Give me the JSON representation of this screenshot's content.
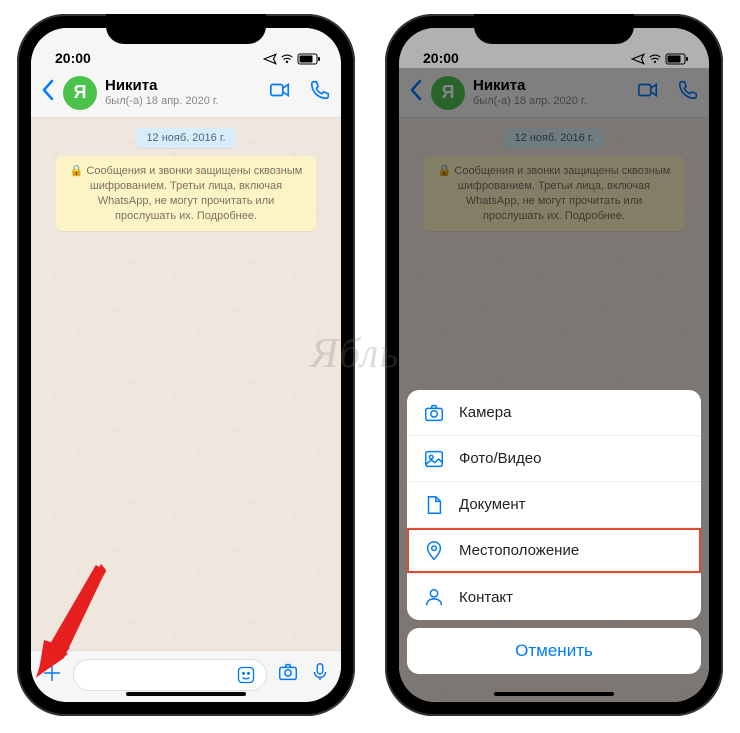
{
  "watermark": "Яблык",
  "status": {
    "time": "20:00"
  },
  "chat": {
    "avatar_letter": "Я",
    "name": "Никита",
    "last_seen": "был(-а) 18 апр. 2020 г.",
    "date_pill": "12 нояб. 2016 г.",
    "encryption_notice": "🔒 Сообщения и звонки защищены сквозным шифрованием. Третьи лица, включая WhatsApp, не могут прочитать или прослушать их. Подробнее."
  },
  "sheet": {
    "camera": "Камера",
    "photo_video": "Фото/Видео",
    "document": "Документ",
    "location": "Местоположение",
    "contact": "Контакт",
    "cancel": "Отменить"
  }
}
